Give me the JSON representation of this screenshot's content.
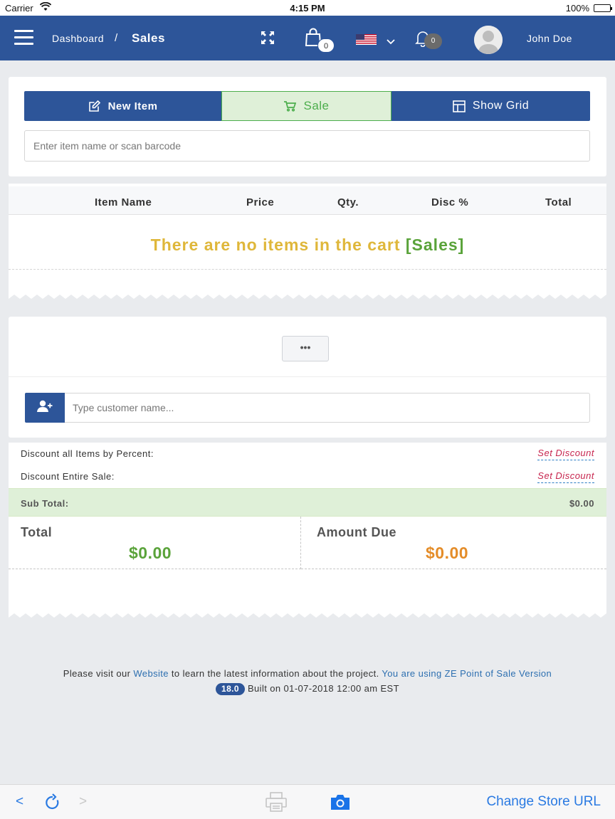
{
  "status_bar": {
    "carrier": "Carrier",
    "time": "4:15 PM",
    "battery": "100%"
  },
  "header": {
    "breadcrumb_parent": "Dashboard",
    "breadcrumb_separator": "/",
    "breadcrumb_current": "Sales",
    "cart_count": "0",
    "notification_count": "0",
    "user_name": "John Doe",
    "accent_color": "#2d5599"
  },
  "tabs": {
    "new_item": "New Item",
    "sale": "Sale",
    "show_grid": "Show Grid"
  },
  "item_search": {
    "placeholder": "Enter item name or scan barcode",
    "value": ""
  },
  "cart": {
    "columns": [
      "Item Name",
      "Price",
      "Qty.",
      "Disc %",
      "Total"
    ],
    "empty_message": "There are no items in the cart",
    "empty_tag": "[Sales]"
  },
  "customer": {
    "more_button": "•••",
    "placeholder": "Type customer name...",
    "value": ""
  },
  "discounts": {
    "items_label": "Discount all Items by Percent:",
    "items_link": "Set Discount",
    "sale_label": "Discount Entire Sale:",
    "sale_link": "Set Discount"
  },
  "totals": {
    "subtotal_label": "Sub Total:",
    "subtotal_value": "$0.00",
    "total_label": "Total",
    "total_value": "$0.00",
    "amount_due_label": "Amount Due",
    "amount_due_value": "$0.00"
  },
  "footer": {
    "text_before_link": "Please visit our",
    "website_link": "Website",
    "text_after_link": "to learn the latest information about the project.",
    "version_text": "You are using ZE Point of Sale Version",
    "version_badge": "18.0",
    "built_text": "Built on 01-07-2018 12:00 am EST"
  },
  "toolbar": {
    "back": "<",
    "forward": ">",
    "change_store": "Change Store URL"
  },
  "icons": {
    "menu": "hamburger-icon",
    "fullscreen": "expand-icon",
    "cart": "shopping-bag-icon",
    "language": "us-flag-icon",
    "notifications": "bell-icon",
    "new_item": "edit-icon",
    "sale": "cart-icon",
    "grid": "grid-icon",
    "add_customer": "user-plus-icon",
    "reload": "reload-icon",
    "print": "printer-icon",
    "camera": "camera-icon"
  }
}
